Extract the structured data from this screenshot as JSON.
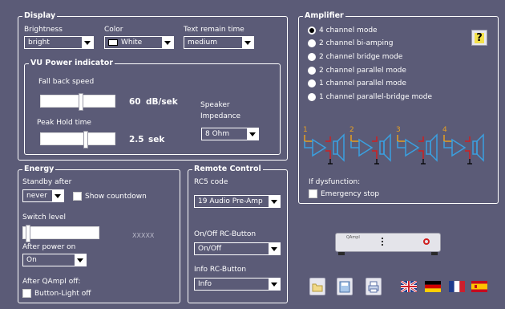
{
  "display": {
    "legend": "Display",
    "brightness_label": "Brightness",
    "brightness_value": "bright",
    "color_label": "Color",
    "color_value": "White",
    "text_remain_label": "Text remain time",
    "text_remain_value": "medium"
  },
  "vu": {
    "legend": "VU Power indicator",
    "fall_back_label": "Fall back speed",
    "fall_back_value": "60",
    "fall_back_unit": "dB/sek",
    "fall_back_level": 0.55,
    "peak_hold_label": "Peak Hold time",
    "peak_hold_value": "2.5",
    "peak_hold_unit": "sek",
    "peak_hold_level": 0.62,
    "speaker_label": "Speaker",
    "impedance_label": "Impedance",
    "impedance_value": "8 Ohm"
  },
  "amplifier": {
    "legend": "Amplifier",
    "modes": [
      "4 channel mode",
      "2 channel bi-amping",
      "2 channel bridge mode",
      "2 channel parallel mode",
      "1 channel parallel mode",
      "1 channel parallel-bridge mode"
    ],
    "selected_index": 0,
    "channels": [
      "1",
      "2",
      "3",
      "4"
    ],
    "if_dysfunction_label": "If dysfunction:",
    "emergency_stop_label": "Emergency stop"
  },
  "energy": {
    "legend": "Energy",
    "standby_label": "Standby after",
    "standby_value": "never",
    "show_countdown_label": "Show countdown",
    "switch_level_label": "Switch level",
    "switch_level_readout": "XXXXX",
    "after_power_on_label": "After power on",
    "after_power_on_value": "On",
    "after_qampi_off_label": "After QAmpI off:",
    "button_light_off_label": "Button-Light off"
  },
  "remote": {
    "legend": "Remote Control",
    "rc5_label": "RC5 code",
    "rc5_value": "19  Audio Pre-Amp",
    "onoff_label": "On/Off RC-Button",
    "onoff_value": "On/Off",
    "info_label": "Info RC-Button",
    "info_value": "Info"
  },
  "device": {
    "badge": "QAmpI"
  },
  "help": {
    "glyph": "?"
  },
  "colors": {
    "background": "#5b5b77",
    "accent_orange": "#e8a020",
    "accent_blue": "#3aa0e0",
    "accent_red": "#d02020"
  }
}
